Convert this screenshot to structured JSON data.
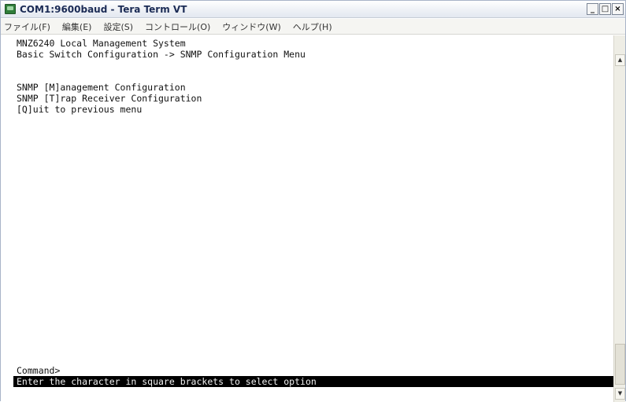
{
  "window": {
    "title": "COM1:9600baud - Tera Term VT",
    "minimize_glyph": "_",
    "maximize_glyph": "□",
    "close_glyph": "×"
  },
  "menu": {
    "items": [
      {
        "label": "ファイル(F)"
      },
      {
        "label": "編集(E)"
      },
      {
        "label": "設定(S)"
      },
      {
        "label": "コントロール(O)"
      },
      {
        "label": "ウィンドウ(W)"
      },
      {
        "label": "ヘルプ(H)"
      }
    ]
  },
  "terminal": {
    "header_line1": "MNZ6240 Local Management System",
    "header_line2": "Basic Switch Configuration -> SNMP Configuration Menu",
    "options": [
      "SNMP [M]anagement Configuration",
      "SNMP [T]rap Receiver Configuration",
      "[Q]uit to previous menu"
    ],
    "prompt": "Command>",
    "status": "Enter the character in square brackets to select option"
  },
  "scrollbar": {
    "up_glyph": "▲",
    "down_glyph": "▼"
  }
}
